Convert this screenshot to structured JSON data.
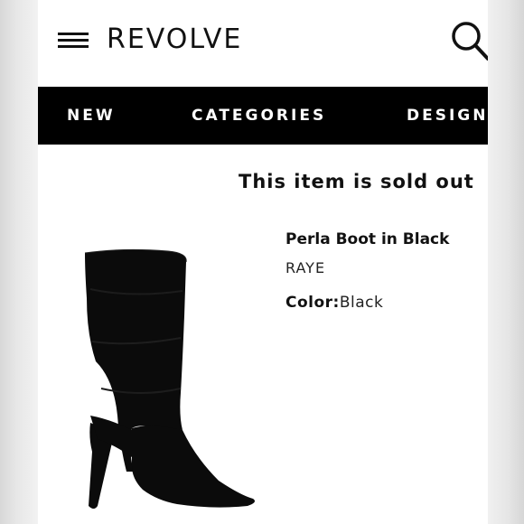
{
  "header": {
    "logo": "REVOLVE",
    "menu_icon": "hamburger-menu-icon",
    "search_icon": "search-icon"
  },
  "nav": {
    "items": [
      "NEW",
      "CATEGORIES",
      "DESIGNERS"
    ]
  },
  "product": {
    "status": "This item is sold out",
    "name": "Perla Boot in Black",
    "brand": "RAYE",
    "color_label": "Color:",
    "color_value": "Black",
    "image": "black-suede-slouch-boot"
  },
  "colors": {
    "nav_background": "#000000",
    "text": "#111111",
    "boot": "#0b0b0b"
  }
}
